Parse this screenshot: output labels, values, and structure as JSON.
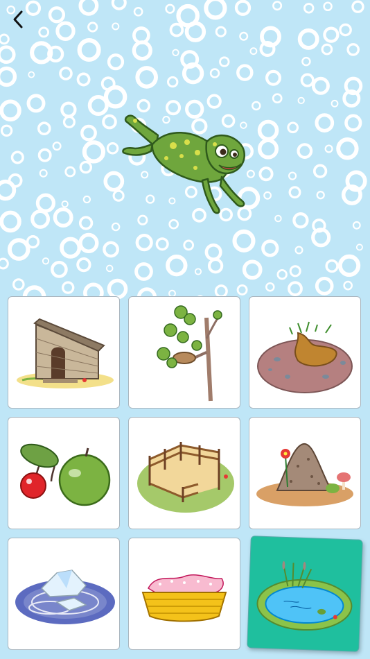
{
  "screen": {
    "name": "frog-home-quiz"
  },
  "header": {
    "back_icon": "chevron-left-icon"
  },
  "prompt": {
    "animal": "frog",
    "icon": "frog-illustration"
  },
  "colors": {
    "background": "#bfe6f7",
    "bubble": "#ffffff",
    "selected_card": "#1fbf9e"
  },
  "choices": [
    {
      "id": "chicken-coop",
      "icon": "wooden-coop-illustration",
      "selected": false
    },
    {
      "id": "bird-nest",
      "icon": "tree-nest-illustration",
      "selected": false
    },
    {
      "id": "burrow",
      "icon": "dirt-burrow-illustration",
      "selected": false
    },
    {
      "id": "fruit",
      "icon": "cherry-apple-illustration",
      "selected": false
    },
    {
      "id": "fenced-pen",
      "icon": "fence-pen-illustration",
      "selected": false
    },
    {
      "id": "anthill",
      "icon": "anthill-illustration",
      "selected": false
    },
    {
      "id": "ice-floe",
      "icon": "iceberg-illustration",
      "selected": false
    },
    {
      "id": "basket",
      "icon": "basket-illustration",
      "selected": false
    },
    {
      "id": "pond",
      "icon": "pond-illustration",
      "selected": true
    }
  ]
}
